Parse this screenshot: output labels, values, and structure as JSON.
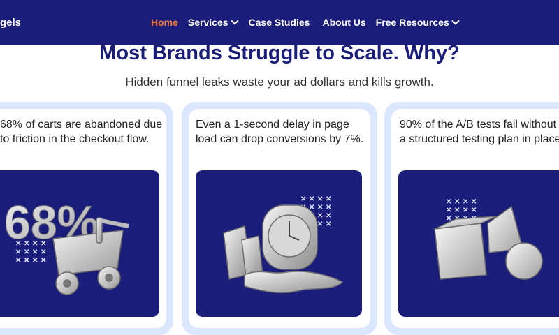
{
  "nav": {
    "logo_text": "gels",
    "items": [
      {
        "label": "Home",
        "active": true,
        "dropdown": false
      },
      {
        "label": "Services",
        "active": false,
        "dropdown": true
      },
      {
        "label": "Case Studies",
        "active": false,
        "dropdown": false
      },
      {
        "label": "About Us",
        "active": false,
        "dropdown": false
      },
      {
        "label": "Free Resources",
        "active": false,
        "dropdown": true
      }
    ]
  },
  "section": {
    "title": "Most Brands Struggle to Scale. Why?",
    "subtitle": "Hidden funnel leaks waste your ad dollars and kills growth."
  },
  "cards": [
    {
      "text": "68% of carts are abandoned due to friction in the checkout flow.",
      "image": "shopping-cart-68-percent",
      "big_label": "68%"
    },
    {
      "text": "Even a 1-second delay in page load can drop conversions by 7%.",
      "image": "melting-stopwatch"
    },
    {
      "text": "90% of the A/B tests fail without a structured testing plan in place.",
      "image": "geometric-shapes"
    }
  ],
  "colors": {
    "brand": "#1a1d7a",
    "accent": "#f07a3a",
    "card_bg": "#dbe6ff"
  }
}
